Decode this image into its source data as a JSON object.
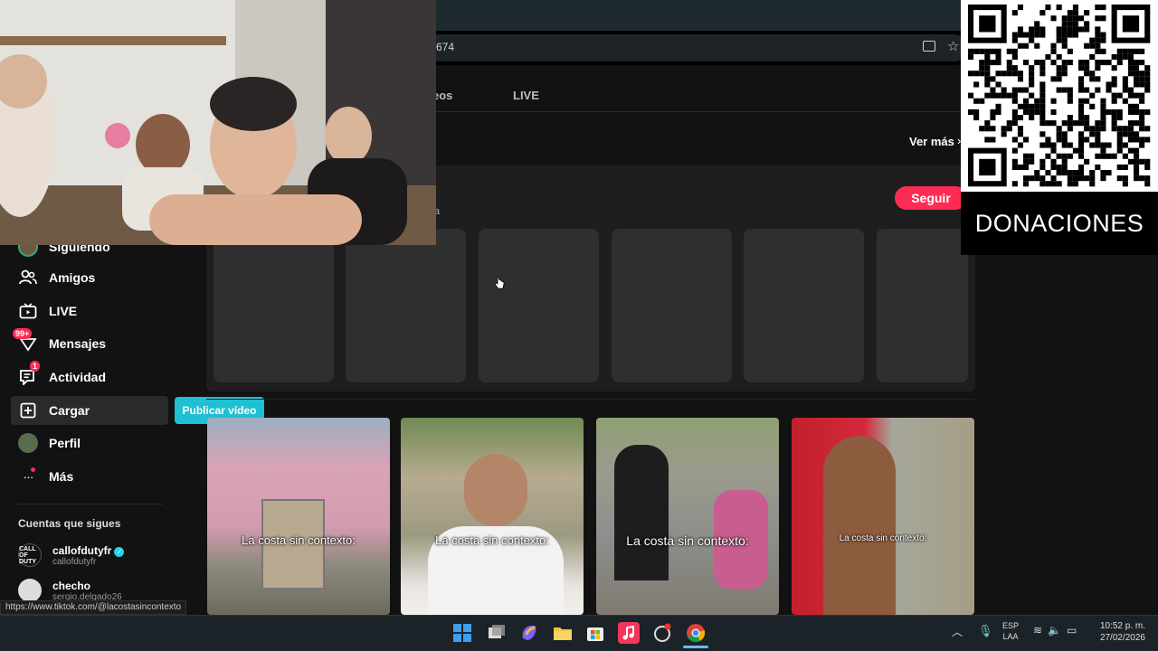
{
  "browser": {
    "url_fragment": "674",
    "icons": [
      "cast-icon",
      "star-icon"
    ]
  },
  "profile_tabs": {
    "videos_label": "eos",
    "live_label": "LIVE"
  },
  "suggested": {
    "see_more_label": "Ver más",
    "follow_label": "Seguir",
    "subtitle_fragment": "a"
  },
  "sidebar": {
    "items": [
      {
        "label": "Siguiendo",
        "icon": "following-avatar-icon"
      },
      {
        "label": "Amigos",
        "icon": "friends-icon"
      },
      {
        "label": "LIVE",
        "icon": "live-tv-icon"
      },
      {
        "label": "Mensajes",
        "icon": "messages-icon",
        "badge": "99+"
      },
      {
        "label": "Actividad",
        "icon": "activity-icon",
        "badge": "1"
      },
      {
        "label": "Cargar",
        "icon": "upload-icon"
      },
      {
        "label": "Perfil",
        "icon": "profile-avatar-icon"
      },
      {
        "label": "Más",
        "icon": "more-dots-icon"
      }
    ],
    "upload_tooltip": "Publicar vídeo",
    "following_title": "Cuentas que sigues",
    "accounts": [
      {
        "name": "callofdutyfr",
        "handle": "callofdutyfr",
        "verified": true,
        "avatar_text": "CALL OF DUTY"
      },
      {
        "name": "checho",
        "handle": "sergio.delgado26",
        "verified": false,
        "avatar_text": ""
      }
    ]
  },
  "videos": [
    {
      "caption": "La costa sin contexto:"
    },
    {
      "caption": "La costa sin contexto:"
    },
    {
      "caption": "La costa sin contexto:"
    },
    {
      "caption": "La costa sin contexto:"
    }
  ],
  "status_url": "https://www.tiktok.com/@lacostasincontexto",
  "overlay": {
    "donations_label": "DONACIONES"
  },
  "taskbar": {
    "lang_line1": "ESP",
    "lang_line2": "LAA",
    "time": "10:52 p. m.",
    "date": "27/02/2026"
  },
  "colors": {
    "accent": "#fe2c55",
    "tooltip": "#20bfd1",
    "panel": "#1e1e1e"
  }
}
